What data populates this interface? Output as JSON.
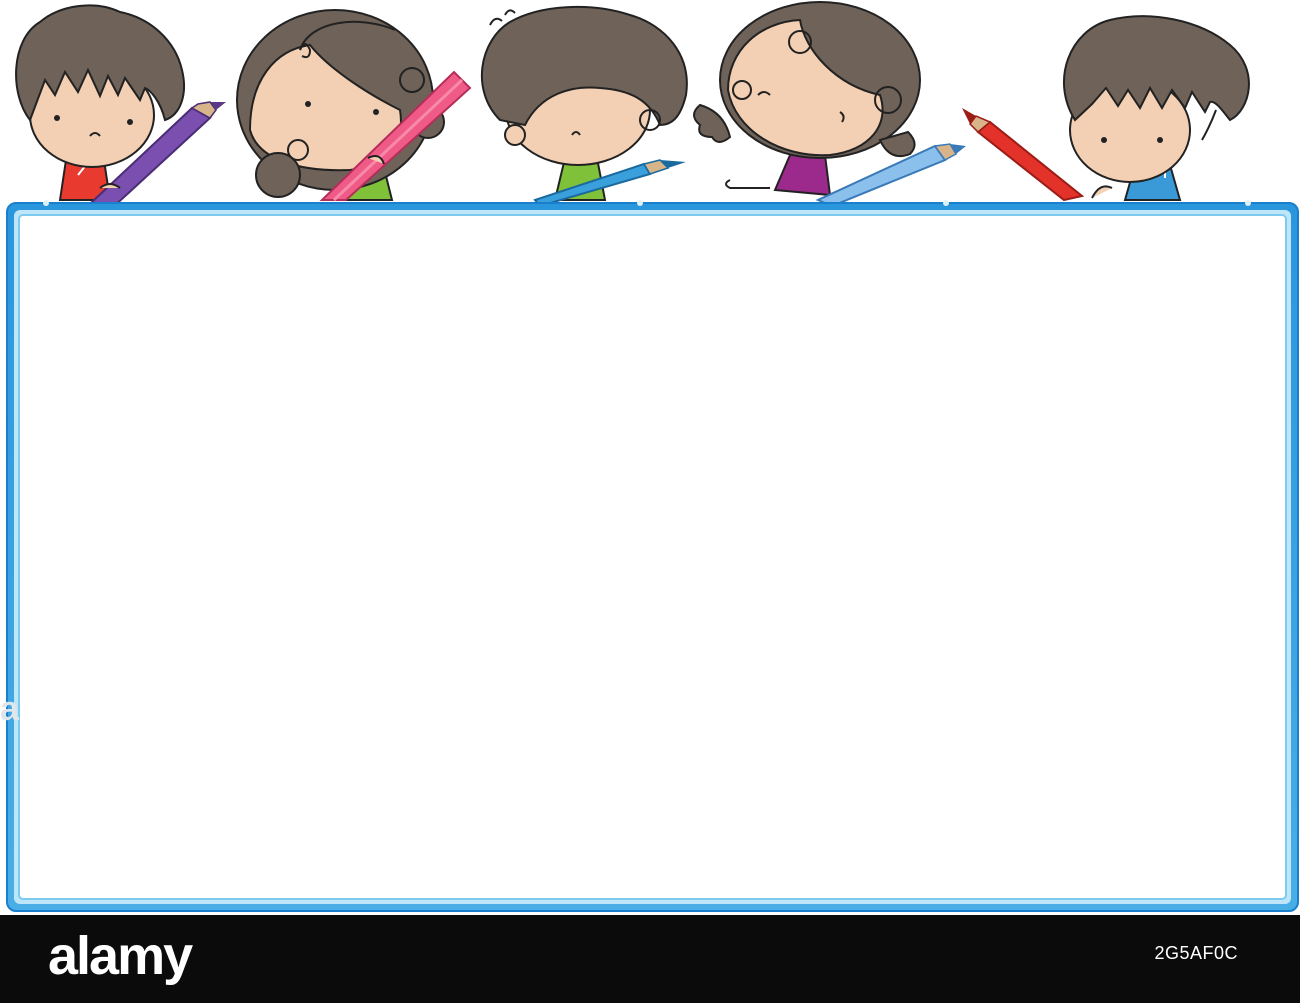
{
  "footer": {
    "logo_text": "alamy",
    "image_id": "2G5AF0C"
  },
  "watermark_text": "a",
  "colors": {
    "frame_blue": "#1e8fd8",
    "frame_light": "#8fd0f2",
    "hair": "#6e6259",
    "skin": "#f3cfb3",
    "footer_bg": "#0b0b0b"
  },
  "characters": [
    {
      "name": "boy-red-shirt",
      "shirt": "#e83a2e",
      "pencil": "#7a4fb0"
    },
    {
      "name": "girl-green-shirt",
      "shirt": "#7fc23a",
      "pencil": "#ef5b86"
    },
    {
      "name": "boy-green-shirt",
      "shirt": "#7fc23a",
      "pencil": "#3aa0dc"
    },
    {
      "name": "girl-purple-shirt",
      "shirt": "#9c2a8c",
      "pencil": "#8cc0ec"
    },
    {
      "name": "boy-blue-shirt",
      "shirt": "#3a9ad8",
      "pencil": "#e3322a"
    }
  ]
}
